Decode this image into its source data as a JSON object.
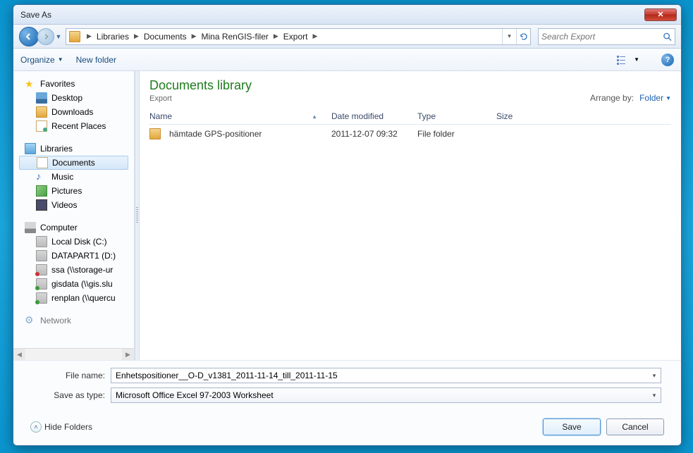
{
  "window": {
    "title": "Save As"
  },
  "breadcrumb": {
    "items": [
      "Libraries",
      "Documents",
      "Mina RenGIS-filer",
      "Export"
    ]
  },
  "search": {
    "placeholder": "Search Export"
  },
  "toolbar": {
    "organize": "Organize",
    "new_folder": "New folder"
  },
  "sidebar": {
    "favorites": {
      "label": "Favorites",
      "items": [
        "Desktop",
        "Downloads",
        "Recent Places"
      ]
    },
    "libraries": {
      "label": "Libraries",
      "items": [
        "Documents",
        "Music",
        "Pictures",
        "Videos"
      ]
    },
    "computer": {
      "label": "Computer",
      "items": [
        "Local Disk (C:)",
        "DATAPART1 (D:)",
        "ssa (\\\\storage-ur",
        "gisdata (\\\\gis.slu",
        "renplan (\\\\quercu"
      ]
    },
    "network": {
      "label": "Network"
    }
  },
  "main": {
    "library_title": "Documents library",
    "library_sub": "Export",
    "arrange_label": "Arrange by:",
    "arrange_value": "Folder",
    "columns": {
      "name": "Name",
      "date": "Date modified",
      "type": "Type",
      "size": "Size"
    },
    "rows": [
      {
        "name": "hämtade GPS-positioner",
        "date": "2011-12-07 09:32",
        "type": "File folder",
        "size": ""
      }
    ]
  },
  "fields": {
    "filename_label": "File name:",
    "filename_value": "Enhetspositioner__O-D_v1381_2011-11-14_till_2011-11-15",
    "savetype_label": "Save as type:",
    "savetype_value": "Microsoft Office Excel 97-2003 Worksheet"
  },
  "footer": {
    "hide_folders": "Hide Folders",
    "save": "Save",
    "cancel": "Cancel"
  }
}
